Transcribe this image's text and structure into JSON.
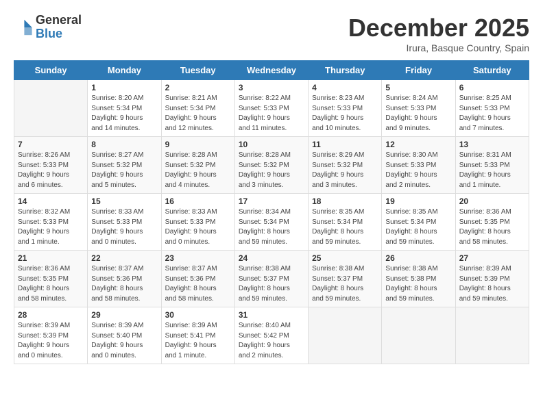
{
  "header": {
    "logo_general": "General",
    "logo_blue": "Blue",
    "month_title": "December 2025",
    "subtitle": "Irura, Basque Country, Spain"
  },
  "days_of_week": [
    "Sunday",
    "Monday",
    "Tuesday",
    "Wednesday",
    "Thursday",
    "Friday",
    "Saturday"
  ],
  "weeks": [
    [
      {
        "day": "",
        "info": ""
      },
      {
        "day": "1",
        "info": "Sunrise: 8:20 AM\nSunset: 5:34 PM\nDaylight: 9 hours\nand 14 minutes."
      },
      {
        "day": "2",
        "info": "Sunrise: 8:21 AM\nSunset: 5:34 PM\nDaylight: 9 hours\nand 12 minutes."
      },
      {
        "day": "3",
        "info": "Sunrise: 8:22 AM\nSunset: 5:33 PM\nDaylight: 9 hours\nand 11 minutes."
      },
      {
        "day": "4",
        "info": "Sunrise: 8:23 AM\nSunset: 5:33 PM\nDaylight: 9 hours\nand 10 minutes."
      },
      {
        "day": "5",
        "info": "Sunrise: 8:24 AM\nSunset: 5:33 PM\nDaylight: 9 hours\nand 9 minutes."
      },
      {
        "day": "6",
        "info": "Sunrise: 8:25 AM\nSunset: 5:33 PM\nDaylight: 9 hours\nand 7 minutes."
      }
    ],
    [
      {
        "day": "7",
        "info": "Sunrise: 8:26 AM\nSunset: 5:33 PM\nDaylight: 9 hours\nand 6 minutes."
      },
      {
        "day": "8",
        "info": "Sunrise: 8:27 AM\nSunset: 5:32 PM\nDaylight: 9 hours\nand 5 minutes."
      },
      {
        "day": "9",
        "info": "Sunrise: 8:28 AM\nSunset: 5:32 PM\nDaylight: 9 hours\nand 4 minutes."
      },
      {
        "day": "10",
        "info": "Sunrise: 8:28 AM\nSunset: 5:32 PM\nDaylight: 9 hours\nand 3 minutes."
      },
      {
        "day": "11",
        "info": "Sunrise: 8:29 AM\nSunset: 5:32 PM\nDaylight: 9 hours\nand 3 minutes."
      },
      {
        "day": "12",
        "info": "Sunrise: 8:30 AM\nSunset: 5:33 PM\nDaylight: 9 hours\nand 2 minutes."
      },
      {
        "day": "13",
        "info": "Sunrise: 8:31 AM\nSunset: 5:33 PM\nDaylight: 9 hours\nand 1 minute."
      }
    ],
    [
      {
        "day": "14",
        "info": "Sunrise: 8:32 AM\nSunset: 5:33 PM\nDaylight: 9 hours\nand 1 minute."
      },
      {
        "day": "15",
        "info": "Sunrise: 8:33 AM\nSunset: 5:33 PM\nDaylight: 9 hours\nand 0 minutes."
      },
      {
        "day": "16",
        "info": "Sunrise: 8:33 AM\nSunset: 5:33 PM\nDaylight: 9 hours\nand 0 minutes."
      },
      {
        "day": "17",
        "info": "Sunrise: 8:34 AM\nSunset: 5:34 PM\nDaylight: 8 hours\nand 59 minutes."
      },
      {
        "day": "18",
        "info": "Sunrise: 8:35 AM\nSunset: 5:34 PM\nDaylight: 8 hours\nand 59 minutes."
      },
      {
        "day": "19",
        "info": "Sunrise: 8:35 AM\nSunset: 5:34 PM\nDaylight: 8 hours\nand 59 minutes."
      },
      {
        "day": "20",
        "info": "Sunrise: 8:36 AM\nSunset: 5:35 PM\nDaylight: 8 hours\nand 58 minutes."
      }
    ],
    [
      {
        "day": "21",
        "info": "Sunrise: 8:36 AM\nSunset: 5:35 PM\nDaylight: 8 hours\nand 58 minutes."
      },
      {
        "day": "22",
        "info": "Sunrise: 8:37 AM\nSunset: 5:36 PM\nDaylight: 8 hours\nand 58 minutes."
      },
      {
        "day": "23",
        "info": "Sunrise: 8:37 AM\nSunset: 5:36 PM\nDaylight: 8 hours\nand 58 minutes."
      },
      {
        "day": "24",
        "info": "Sunrise: 8:38 AM\nSunset: 5:37 PM\nDaylight: 8 hours\nand 59 minutes."
      },
      {
        "day": "25",
        "info": "Sunrise: 8:38 AM\nSunset: 5:37 PM\nDaylight: 8 hours\nand 59 minutes."
      },
      {
        "day": "26",
        "info": "Sunrise: 8:38 AM\nSunset: 5:38 PM\nDaylight: 8 hours\nand 59 minutes."
      },
      {
        "day": "27",
        "info": "Sunrise: 8:39 AM\nSunset: 5:39 PM\nDaylight: 8 hours\nand 59 minutes."
      }
    ],
    [
      {
        "day": "28",
        "info": "Sunrise: 8:39 AM\nSunset: 5:39 PM\nDaylight: 9 hours\nand 0 minutes."
      },
      {
        "day": "29",
        "info": "Sunrise: 8:39 AM\nSunset: 5:40 PM\nDaylight: 9 hours\nand 0 minutes."
      },
      {
        "day": "30",
        "info": "Sunrise: 8:39 AM\nSunset: 5:41 PM\nDaylight: 9 hours\nand 1 minute."
      },
      {
        "day": "31",
        "info": "Sunrise: 8:40 AM\nSunset: 5:42 PM\nDaylight: 9 hours\nand 2 minutes."
      },
      {
        "day": "",
        "info": ""
      },
      {
        "day": "",
        "info": ""
      },
      {
        "day": "",
        "info": ""
      }
    ]
  ]
}
